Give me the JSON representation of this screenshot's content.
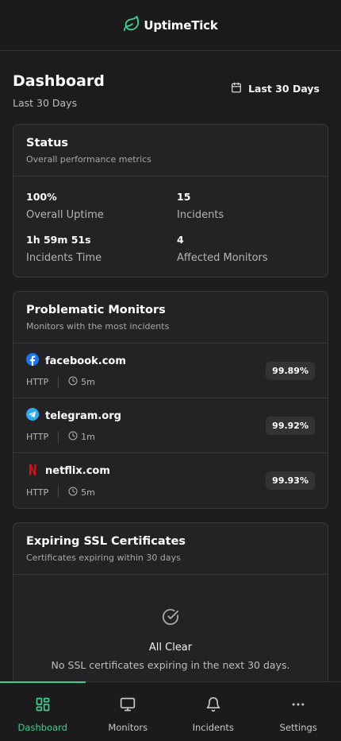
{
  "app": {
    "name": "UptimeTick"
  },
  "colors": {
    "accent": "#3ecf8e",
    "background": "#1c1c1e",
    "card": "#232325"
  },
  "page": {
    "title": "Dashboard",
    "subtitle": "Last 30 Days",
    "range_label": "Last 30 Days"
  },
  "status": {
    "title": "Status",
    "description": "Overall performance metrics",
    "metrics": [
      {
        "value": "100%",
        "label": "Overall Uptime"
      },
      {
        "value": "15",
        "label": "Incidents"
      },
      {
        "value": "1h 59m 51s",
        "label": "Incidents Time"
      },
      {
        "value": "4",
        "label": "Affected Monitors"
      }
    ]
  },
  "problematic": {
    "title": "Problematic Monitors",
    "description": "Monitors with the most incidents",
    "monitors": [
      {
        "name": "facebook.com",
        "type": "HTTP",
        "interval": "5m",
        "uptime": "99.89%",
        "icon": "facebook-icon"
      },
      {
        "name": "telegram.org",
        "type": "HTTP",
        "interval": "1m",
        "uptime": "99.92%",
        "icon": "telegram-icon"
      },
      {
        "name": "netflix.com",
        "type": "HTTP",
        "interval": "5m",
        "uptime": "99.93%",
        "icon": "netflix-icon"
      }
    ]
  },
  "ssl": {
    "title": "Expiring SSL Certificates",
    "description": "Certificates expiring within 30 days",
    "empty_title": "All Clear",
    "empty_description": "No SSL certificates expiring in the next 30 days."
  },
  "nav": {
    "items": [
      {
        "label": "Dashboard",
        "icon": "dashboard-icon",
        "active": true
      },
      {
        "label": "Monitors",
        "icon": "monitor-icon",
        "active": false
      },
      {
        "label": "Incidents",
        "icon": "bell-icon",
        "active": false
      },
      {
        "label": "Settings",
        "icon": "more-icon",
        "active": false
      }
    ]
  }
}
